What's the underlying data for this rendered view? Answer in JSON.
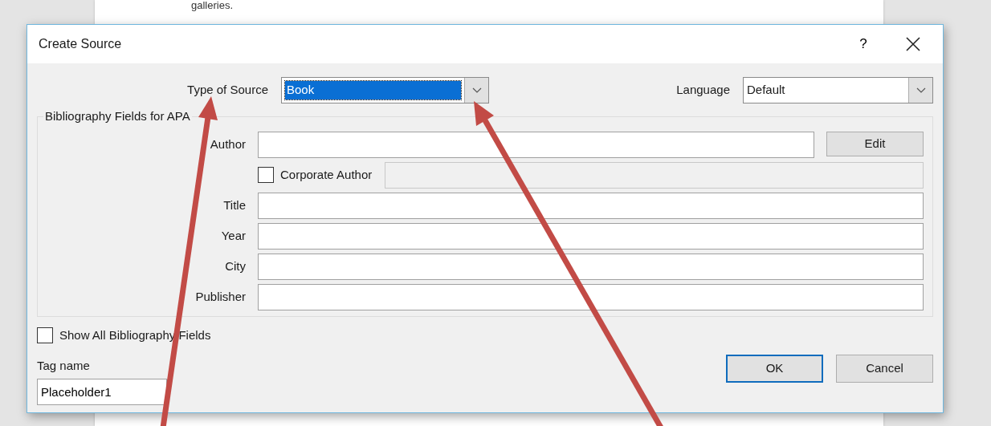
{
  "document": {
    "text": "galleries."
  },
  "dialog": {
    "title": "Create Source",
    "help": "?",
    "type_of_source": {
      "label": "Type of Source",
      "value": "Book",
      "value_highlighted": true
    },
    "language": {
      "label": "Language",
      "value": "Default"
    },
    "group": {
      "legend": "Bibliography Fields for APA",
      "rows": [
        {
          "kind": "with_button",
          "label": "Author",
          "button": "Edit"
        },
        {
          "kind": "checkbox_field",
          "label": "Corporate Author",
          "checked": false,
          "disabled": true
        },
        {
          "kind": "plain",
          "label": "Title"
        },
        {
          "kind": "plain",
          "label": "Year"
        },
        {
          "kind": "plain",
          "label": "City"
        },
        {
          "kind": "plain",
          "label": "Publisher"
        }
      ]
    },
    "show_all": {
      "label": "Show All Bibliography Fields",
      "checked": false
    },
    "tag_name": {
      "label": "Tag name",
      "value": "Placeholder1"
    },
    "buttons": [
      {
        "label": "OK",
        "default": true
      },
      {
        "label": "Cancel",
        "default": false
      }
    ]
  }
}
